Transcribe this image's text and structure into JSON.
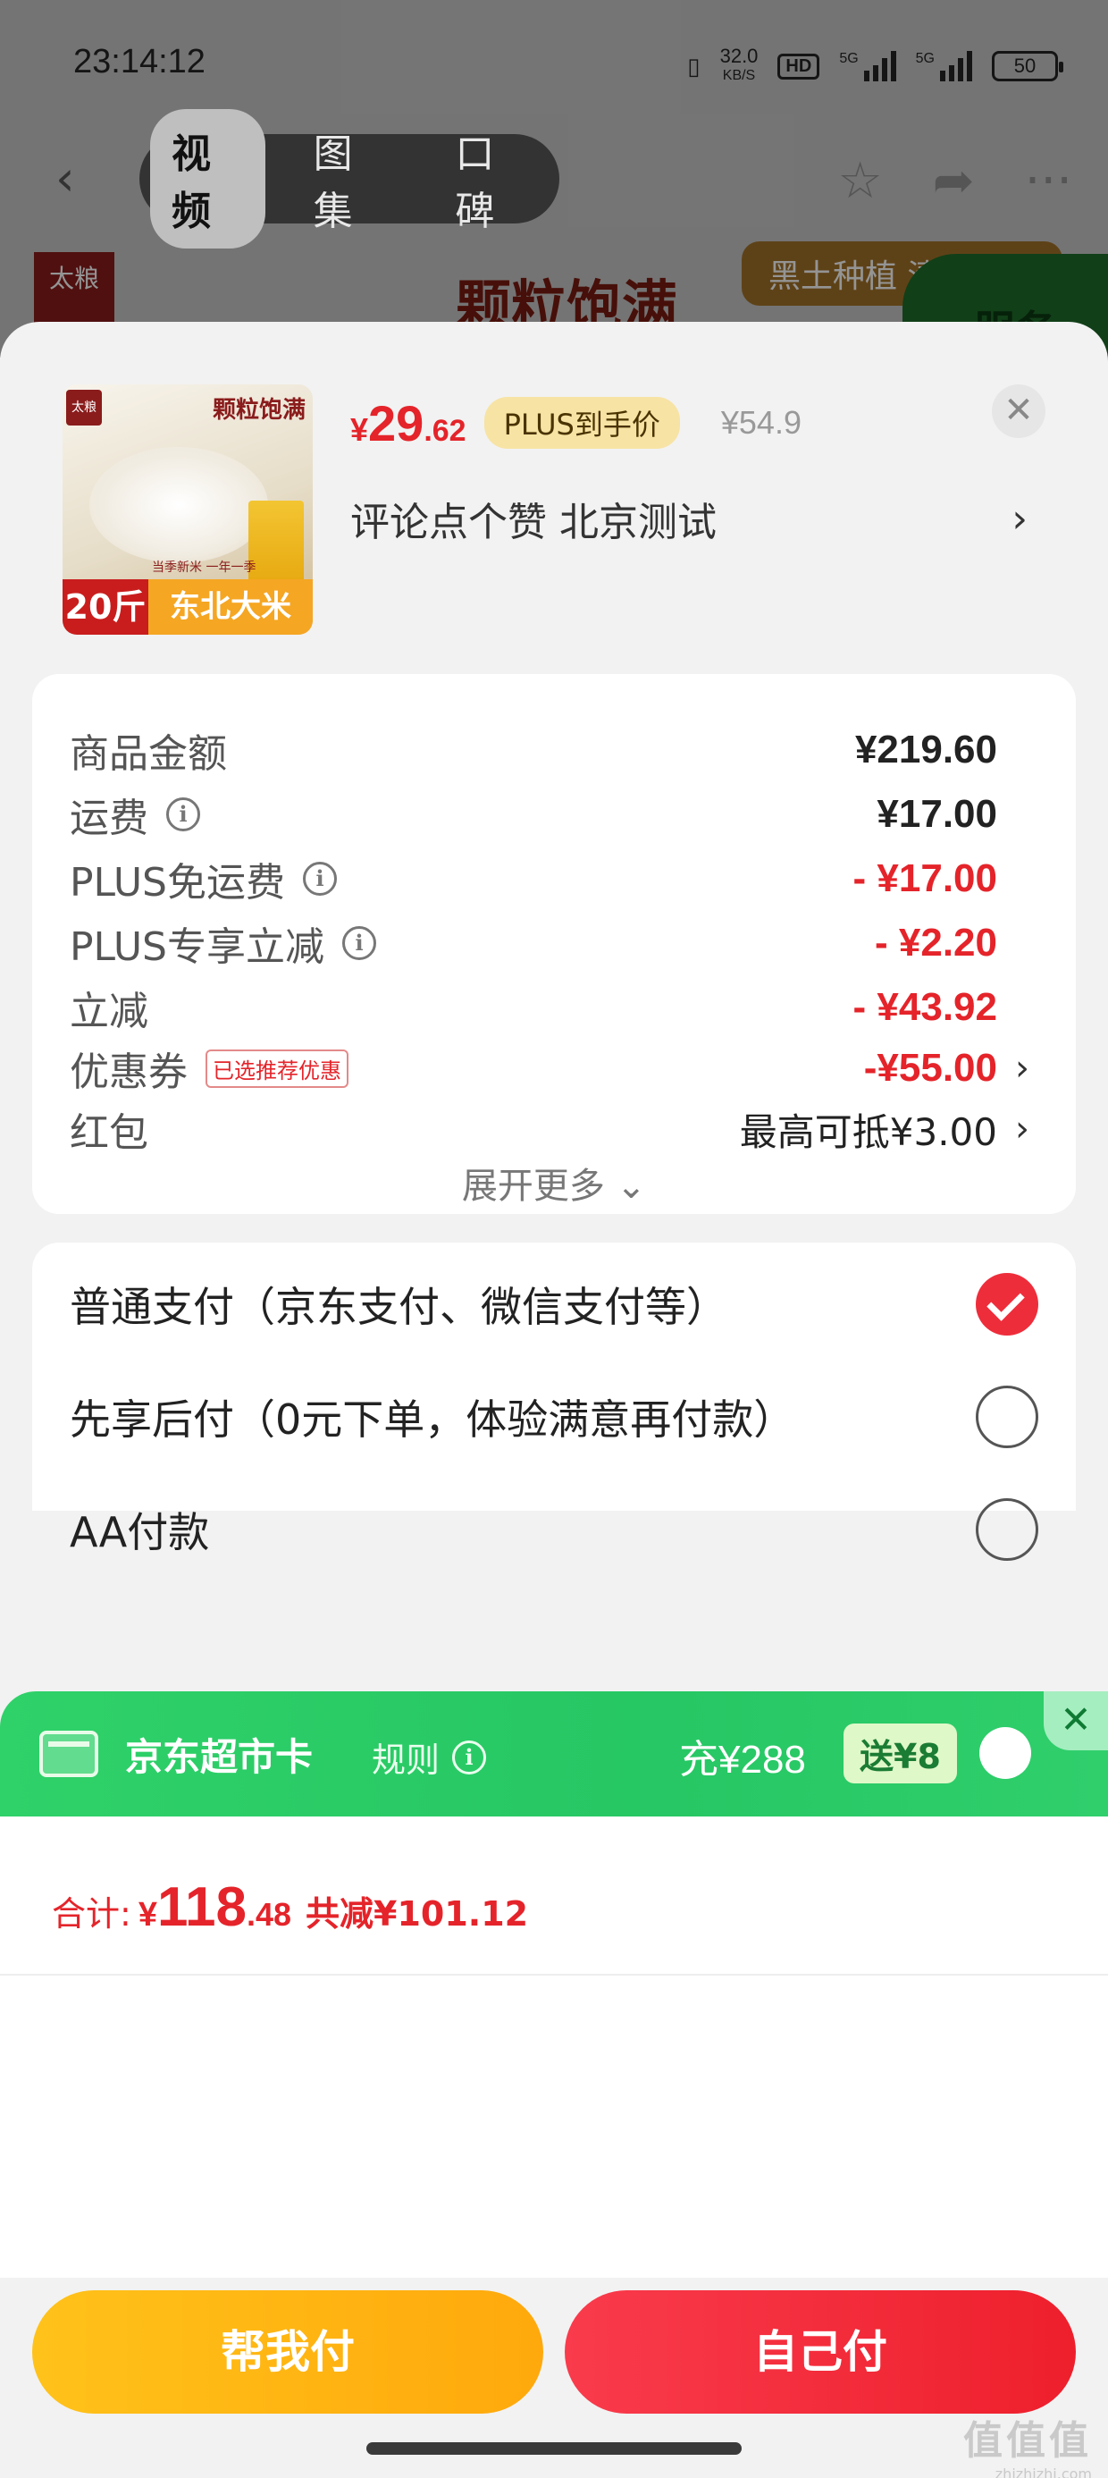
{
  "status_bar": {
    "time": "23:14:12",
    "speed_value": "32.0",
    "speed_unit": "KB/S",
    "hd_label": "HD",
    "sim1_label": "5G",
    "sim2_label": "5G",
    "battery": "50"
  },
  "top_nav": {
    "back_icon": "chevron-left-icon",
    "tabs": [
      {
        "label": "视频",
        "active": true
      },
      {
        "label": "图集",
        "active": false
      },
      {
        "label": "口碑",
        "active": false
      }
    ],
    "actions": [
      "star-icon",
      "share-icon",
      "more-icon"
    ]
  },
  "banner": {
    "brand": "太粮",
    "title": "颗粒饱满",
    "tag": "黑土种植 清香自然",
    "corner": "服务"
  },
  "product": {
    "thumb_brand": "太粮",
    "thumb_title": "颗粒饱满",
    "thumb_slogan": "当季新米 一年一季",
    "thumb_weight": "20斤",
    "thumb_type": "东北大米",
    "price_symbol": "¥",
    "price_int": "29",
    "price_dec": ".62",
    "plus_badge": "PLUS到手价",
    "original_price": "¥54.9",
    "spec": "评论点个赞  北京测试"
  },
  "fees": [
    {
      "label": "商品金额",
      "info": false,
      "tag": "",
      "value": "¥219.60",
      "style": "normal",
      "chevron": false
    },
    {
      "label": "运费",
      "info": true,
      "tag": "",
      "value": "¥17.00",
      "style": "normal",
      "chevron": false
    },
    {
      "label": "PLUS免运费",
      "info": true,
      "tag": "",
      "value": "- ¥17.00",
      "style": "red",
      "chevron": false
    },
    {
      "label": "PLUS专享立减",
      "info": true,
      "tag": "",
      "value": "- ¥2.20",
      "style": "red",
      "chevron": false
    },
    {
      "label": "立减",
      "info": false,
      "tag": "",
      "value": "- ¥43.92",
      "style": "red",
      "chevron": false
    },
    {
      "label": "优惠券",
      "info": false,
      "tag": "已选推荐优惠",
      "value": "-¥55.00",
      "style": "red",
      "chevron": true
    },
    {
      "label": "红包",
      "info": false,
      "tag": "",
      "value": "最高可抵¥3.00",
      "style": "plain",
      "chevron": true
    }
  ],
  "expand_label": "展开更多",
  "payment_options": [
    {
      "label": "普通支付（京东支付、微信支付等）",
      "selected": true
    },
    {
      "label": "先享后付（0元下单，体验满意再付款）",
      "selected": false
    },
    {
      "label": "AA付款",
      "selected": false
    }
  ],
  "promo": {
    "title": "京东超市卡",
    "rule": "规则",
    "charge": "充¥288",
    "gift": "送¥8",
    "accent": "#2fd169"
  },
  "total": {
    "label": "合计:",
    "symbol": "¥",
    "int": "118",
    "dec": ".48",
    "saved": "共减¥101.12"
  },
  "buttons": {
    "help_pay": "帮我付",
    "self_pay": "自己付"
  },
  "watermark": {
    "big": "值值值",
    "small": "zhizhizhi.com"
  },
  "colors": {
    "price_red": "#e4242a",
    "help_yellow": "#ffb412",
    "self_red": "#f32c3b"
  }
}
